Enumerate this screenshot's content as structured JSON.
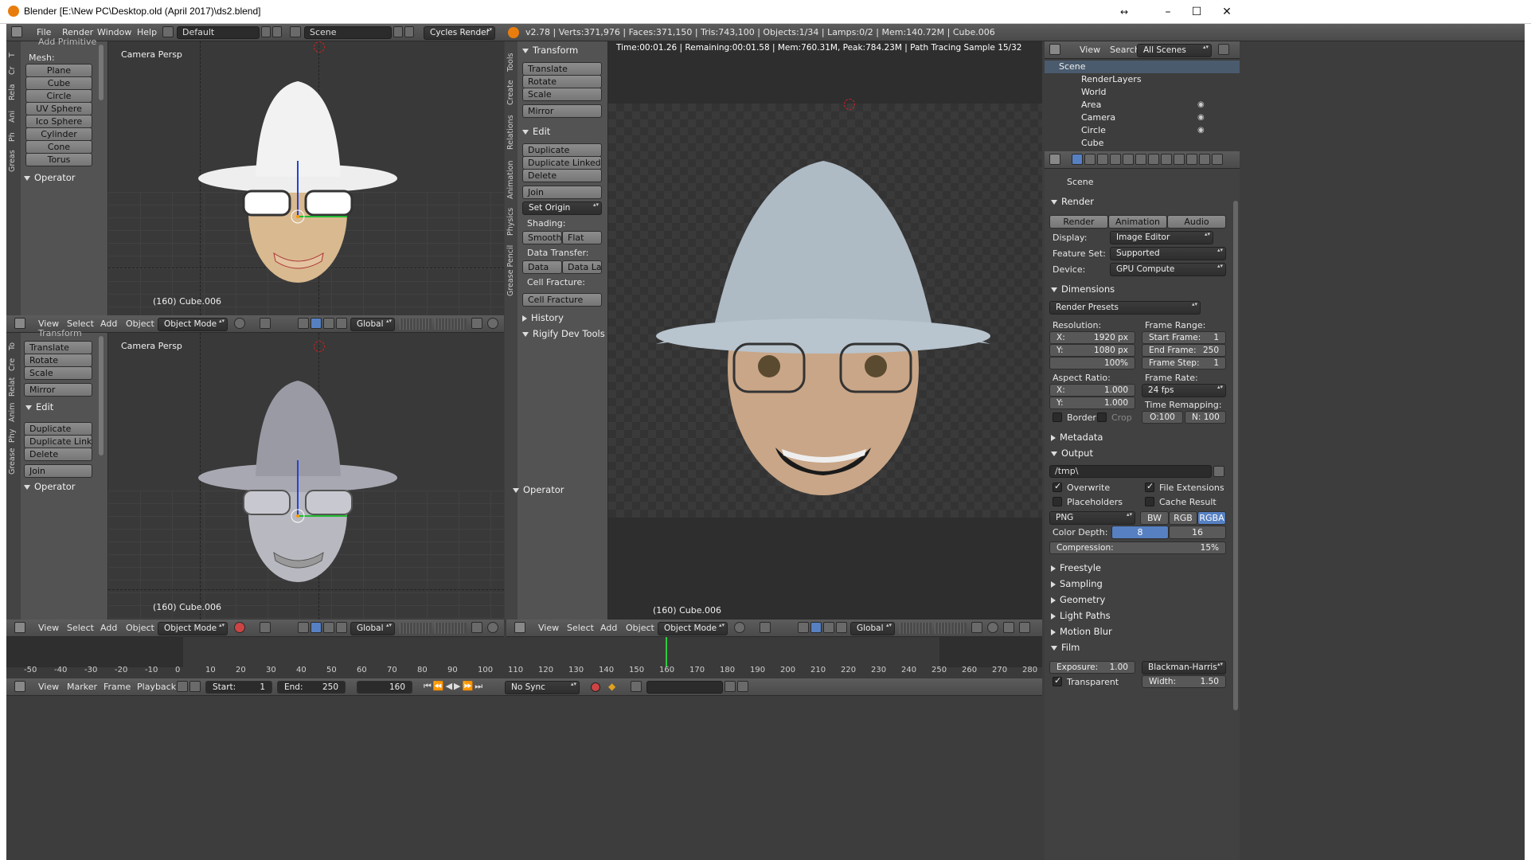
{
  "window": {
    "title": "Blender [E:\\New PC\\Desktop.old (April 2017)\\ds2.blend]",
    "restore_glyph": "↔",
    "minimize": "–",
    "maximize": "☐",
    "close": "✕"
  },
  "info_bar": {
    "menus": [
      "File",
      "Render",
      "Window",
      "Help"
    ],
    "screen_layout": "Default",
    "scene": "Scene",
    "engine": "Cycles Render",
    "stats": "v2.78 | Verts:371,976 | Faces:371,150 | Tris:743,100 | Objects:1/34 | Lamps:0/2 | Mem:140.72M | Cube.006"
  },
  "tool_shelf_top": {
    "tabs": [
      "T",
      "Cr",
      "Rela",
      "Ani",
      "Ph",
      "Greas"
    ],
    "section_partial": "Add Primitive",
    "mesh_label": "Mesh:",
    "mesh_items": [
      "Plane",
      "Cube",
      "Circle",
      "UV Sphere",
      "Ico Sphere",
      "Cylinder",
      "Cone",
      "Torus"
    ],
    "operator": "Operator"
  },
  "viewport_top": {
    "label": "Camera Persp",
    "object": "(160) Cube.006"
  },
  "view3d_header": {
    "menus": [
      "View",
      "Select",
      "Add",
      "Object"
    ],
    "mode": "Object Mode",
    "orientation": "Global"
  },
  "tool_shelf_bottom": {
    "tabs": [
      "To",
      "Cre",
      "Relat",
      "Anim",
      "Phy",
      "Grease"
    ],
    "section_partial": "Transform",
    "transform": [
      "Translate",
      "Rotate",
      "Scale"
    ],
    "mirror": "Mirror",
    "edit_head": "Edit",
    "edit": [
      "Duplicate",
      "Duplicate Linked",
      "Delete"
    ],
    "join": "Join",
    "operator": "Operator"
  },
  "viewport_bottom": {
    "label": "Camera Persp",
    "object": "(160) Cube.006"
  },
  "tool_shelf_mid": {
    "tabs": [
      "Tools",
      "Create",
      "Relations",
      "Animation",
      "Physics",
      "Grease Pencil"
    ],
    "transform_head": "Transform",
    "transform": [
      "Translate",
      "Rotate",
      "Scale"
    ],
    "mirror": "Mirror",
    "edit_head": "Edit",
    "edit": [
      "Duplicate",
      "Duplicate Linked",
      "Delete"
    ],
    "join": "Join",
    "set_origin": "Set Origin",
    "shading_label": "Shading:",
    "smooth": "Smooth",
    "flat": "Flat",
    "data_transfer_label": "Data Transfer:",
    "data": "Data",
    "data_layo": "Data Layo",
    "cell_fracture_label": "Cell Fracture:",
    "cell_fracture": "Cell Fracture",
    "history": "History",
    "rigify": "Rigify Dev Tools",
    "operator": "Operator"
  },
  "render_view": {
    "status": "Time:00:01.26 | Remaining:00:01.58 | Mem:760.31M, Peak:784.23M | Path Tracing Sample 15/32",
    "object": "(160) Cube.006"
  },
  "outliner": {
    "menus": [
      "View",
      "Search"
    ],
    "filter": "All Scenes",
    "items": [
      {
        "name": "Scene",
        "depth": 0
      },
      {
        "name": "RenderLayers",
        "depth": 1
      },
      {
        "name": "World",
        "depth": 1
      },
      {
        "name": "Area",
        "depth": 1
      },
      {
        "name": "Camera",
        "depth": 1
      },
      {
        "name": "Circle",
        "depth": 1
      },
      {
        "name": "Cube",
        "depth": 1
      }
    ]
  },
  "properties": {
    "context": "Scene",
    "render_head": "Render",
    "render_btn": "Render",
    "animation_btn": "Animation",
    "audio_btn": "Audio",
    "display_label": "Display:",
    "display": "Image Editor",
    "feature_label": "Feature Set:",
    "feature": "Supported",
    "device_label": "Device:",
    "device": "GPU Compute",
    "dimensions_head": "Dimensions",
    "presets": "Render Presets",
    "resolution_label": "Resolution:",
    "res_x_label": "X:",
    "res_x": "1920 px",
    "res_y_label": "Y:",
    "res_y": "1080 px",
    "res_pct": "100%",
    "frame_range_label": "Frame Range:",
    "start_label": "Start Frame:",
    "start": "1",
    "end_label": "End Frame:",
    "end": "250",
    "step_label": "Frame Step:",
    "step": "1",
    "aspect_label": "Aspect Ratio:",
    "asp_x_label": "X:",
    "asp_x": "1.000",
    "asp_y_label": "Y:",
    "asp_y": "1.000",
    "frame_rate_label": "Frame Rate:",
    "fps": "24 fps",
    "time_remap_label": "Time Remapping:",
    "remap_old": "O:100",
    "remap_new": "N: 100",
    "border": "Border",
    "crop": "Crop",
    "metadata_head": "Metadata",
    "output_head": "Output",
    "output_path": "/tmp\\",
    "overwrite": "Overwrite",
    "file_ext": "File Extensions",
    "placeholders": "Placeholders",
    "cache": "Cache Result",
    "format": "PNG",
    "bw": "BW",
    "rgb": "RGB",
    "rgba": "RGBA",
    "color_depth_label": "Color Depth:",
    "depth8": "8",
    "depth16": "16",
    "compression_label": "Compression:",
    "compression": "15%",
    "collapsed": [
      "Freestyle",
      "Sampling",
      "Geometry",
      "Light Paths",
      "Motion Blur"
    ],
    "film_head": "Film",
    "exposure_label": "Exposure:",
    "exposure": "1.00",
    "filter": "Blackman-Harris",
    "transparent": "Transparent",
    "width_label": "Width:",
    "width": "1.50"
  },
  "timeline": {
    "ticks": [
      "-50",
      "-40",
      "-30",
      "-20",
      "-10",
      "0",
      "10",
      "20",
      "30",
      "40",
      "50",
      "60",
      "70",
      "80",
      "90",
      "100",
      "110",
      "120",
      "130",
      "140",
      "150",
      "160",
      "170",
      "180",
      "190",
      "200",
      "210",
      "220",
      "230",
      "240",
      "250",
      "260",
      "270",
      "280"
    ],
    "menus": [
      "View",
      "Marker",
      "Frame",
      "Playback"
    ],
    "start_label": "Start:",
    "start": "1",
    "end_label": "End:",
    "end": "250",
    "current": "160",
    "sync": "No Sync"
  },
  "colors": {
    "accent_blue": "#5680c2",
    "current_frame": "#2ecc40",
    "cursor": "#cc2222"
  }
}
